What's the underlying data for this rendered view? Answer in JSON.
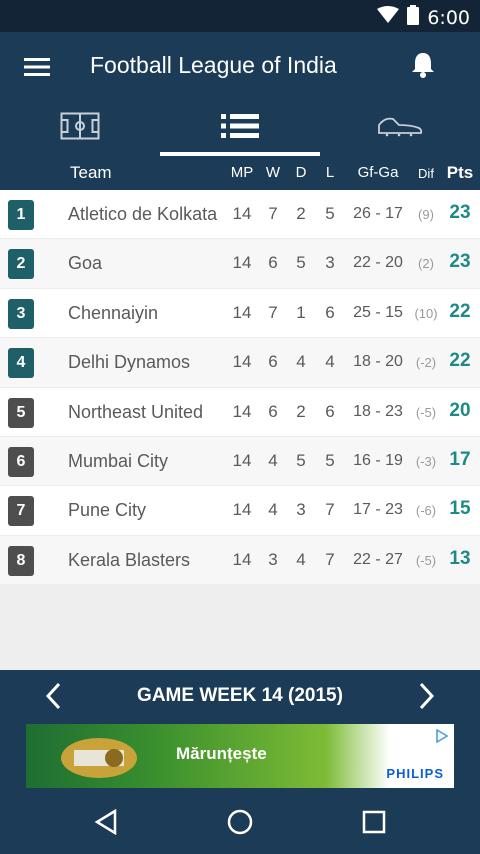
{
  "status_bar": {
    "time": "6:00",
    "icons": [
      "wifi-icon",
      "battery-icon"
    ]
  },
  "app_bar": {
    "title": "Football League of India",
    "menu_icon": "menu-icon",
    "bell_icon": "bell-icon"
  },
  "tabs": [
    {
      "icon": "pitch-icon",
      "active": false
    },
    {
      "icon": "standings-list-icon",
      "active": true
    },
    {
      "icon": "boot-icon",
      "active": false
    }
  ],
  "columns": {
    "team": "Team",
    "mp": "MP",
    "w": "W",
    "d": "D",
    "l": "L",
    "gfga": "Gf-Ga",
    "dif": "Dif",
    "pts": "Pts"
  },
  "standings": [
    {
      "pos": "1",
      "team": "Atletico de Kolkata",
      "mp": "14",
      "w": "7",
      "d": "2",
      "l": "5",
      "gfga": "26 - 17",
      "dif": "(9)",
      "pts": "23",
      "highlight": true
    },
    {
      "pos": "2",
      "team": "Goa",
      "mp": "14",
      "w": "6",
      "d": "5",
      "l": "3",
      "gfga": "22 - 20",
      "dif": "(2)",
      "pts": "23",
      "highlight": true
    },
    {
      "pos": "3",
      "team": "Chennaiyin",
      "mp": "14",
      "w": "7",
      "d": "1",
      "l": "6",
      "gfga": "25 - 15",
      "dif": "(10)",
      "pts": "22",
      "highlight": true
    },
    {
      "pos": "4",
      "team": "Delhi Dynamos",
      "mp": "14",
      "w": "6",
      "d": "4",
      "l": "4",
      "gfga": "18 - 20",
      "dif": "(-2)",
      "pts": "22",
      "highlight": true
    },
    {
      "pos": "5",
      "team": "Northeast United",
      "mp": "14",
      "w": "6",
      "d": "2",
      "l": "6",
      "gfga": "18 - 23",
      "dif": "(-5)",
      "pts": "20",
      "highlight": false
    },
    {
      "pos": "6",
      "team": "Mumbai City",
      "mp": "14",
      "w": "4",
      "d": "5",
      "l": "5",
      "gfga": "16 - 19",
      "dif": "(-3)",
      "pts": "17",
      "highlight": false
    },
    {
      "pos": "7",
      "team": "Pune City",
      "mp": "14",
      "w": "4",
      "d": "3",
      "l": "7",
      "gfga": "17 - 23",
      "dif": "(-6)",
      "pts": "15",
      "highlight": false
    },
    {
      "pos": "8",
      "team": "Kerala Blasters",
      "mp": "14",
      "w": "3",
      "d": "4",
      "l": "7",
      "gfga": "22 - 27",
      "dif": "(-5)",
      "pts": "13",
      "highlight": false
    }
  ],
  "week_nav": {
    "title": "GAME WEEK 14 (2015)",
    "prev_icon": "chevron-left-icon",
    "next_icon": "chevron-right-icon"
  },
  "ad": {
    "text": "Mărunțește",
    "brand": "PHILIPS",
    "choices_icon": "ad-choices-icon"
  },
  "nav_bar": {
    "back_icon": "back-icon",
    "home_icon": "home-icon",
    "recents_icon": "recents-icon"
  },
  "colors": {
    "primary": "#1b3b57",
    "status_bar": "#132437",
    "accent_points": "#1e8a86",
    "top_badge": "#1e5f68",
    "rest_badge": "#4e4e4e"
  }
}
